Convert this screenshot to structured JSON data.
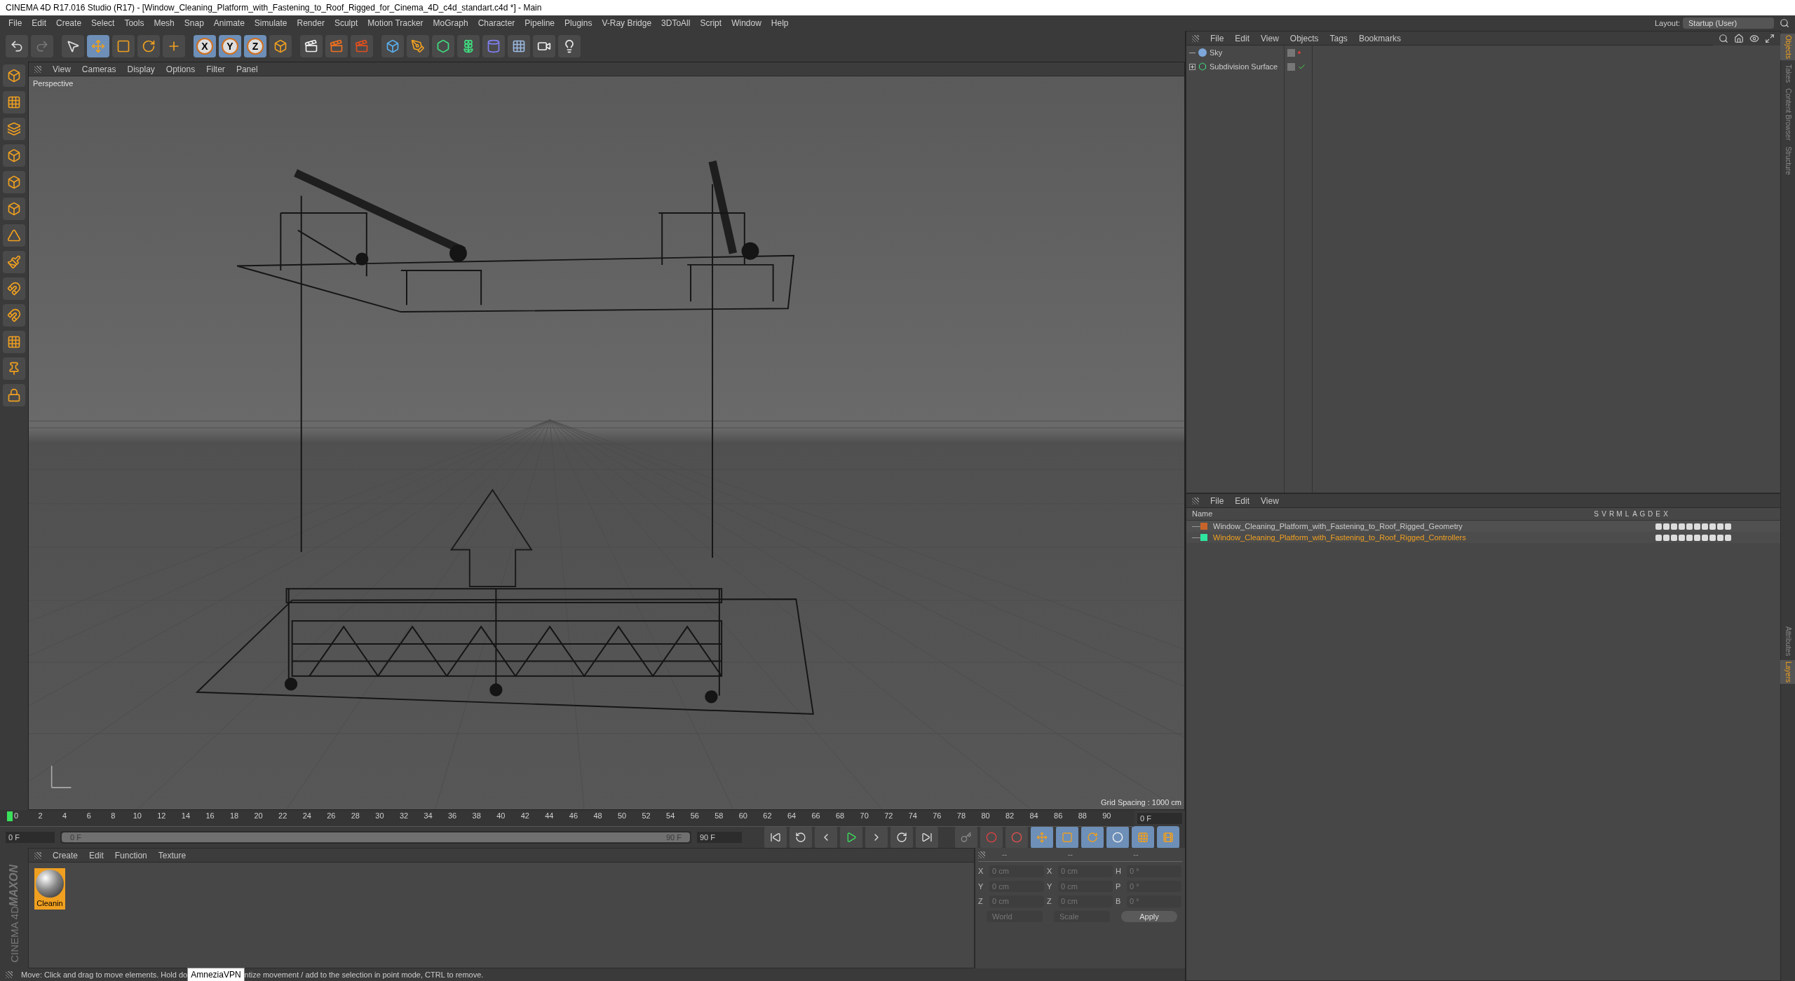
{
  "window": {
    "title": "CINEMA 4D R17.016 Studio (R17) - [Window_Cleaning_Platform_with_Fastening_to_Roof_Rigged_for_Cinema_4D_c4d_standart.c4d *] - Main"
  },
  "menu": [
    "File",
    "Edit",
    "Create",
    "Select",
    "Tools",
    "Mesh",
    "Snap",
    "Animate",
    "Simulate",
    "Render",
    "Sculpt",
    "Motion Tracker",
    "MoGraph",
    "Character",
    "Pipeline",
    "Plugins",
    "V-Ray Bridge",
    "3DToAll",
    "Script",
    "Window",
    "Help"
  ],
  "layout": {
    "label": "Layout:",
    "value": "Startup (User)"
  },
  "axis_buttons": [
    {
      "label": "X",
      "selected": true
    },
    {
      "label": "Y",
      "selected": true
    },
    {
      "label": "Z",
      "selected": true
    }
  ],
  "viewport": {
    "menu": [
      "View",
      "Cameras",
      "Display",
      "Options",
      "Filter",
      "Panel"
    ],
    "camera": "Perspective",
    "grid_spacing": "Grid Spacing : 1000 cm"
  },
  "timeline": {
    "ticks": [
      "0",
      "2",
      "4",
      "6",
      "8",
      "10",
      "12",
      "14",
      "16",
      "18",
      "20",
      "22",
      "24",
      "26",
      "28",
      "30",
      "32",
      "34",
      "36",
      "38",
      "40",
      "42",
      "44",
      "46",
      "48",
      "50",
      "52",
      "54",
      "56",
      "58",
      "60",
      "62",
      "64",
      "66",
      "68",
      "70",
      "72",
      "74",
      "76",
      "78",
      "80",
      "82",
      "84",
      "86",
      "88",
      "90"
    ],
    "current_frame": "0 F",
    "start_field": "0 F",
    "range": {
      "start": "0 F",
      "end": "90 F",
      "level": 1.0
    },
    "end_field": "90 F",
    "level": 0.0
  },
  "material_manager": {
    "menu": [
      "Create",
      "Edit",
      "Function",
      "Texture"
    ],
    "materials": [
      {
        "name": "Cleanin",
        "selected": true
      }
    ]
  },
  "brand": {
    "line1": "MAXON",
    "line2": "CINEMA 4D"
  },
  "coordinates": {
    "headers": [
      "--",
      "--",
      "--"
    ],
    "rows": [
      {
        "axis_a": "X",
        "position": "0 cm",
        "axis_b": "X",
        "size": "0 cm",
        "axis_c": "H",
        "rotation": "0 °"
      },
      {
        "axis_a": "Y",
        "position": "0 cm",
        "axis_b": "Y",
        "size": "0 cm",
        "axis_c": "P",
        "rotation": "0 °"
      },
      {
        "axis_a": "Z",
        "position": "0 cm",
        "axis_b": "Z",
        "size": "0 cm",
        "axis_c": "B",
        "rotation": "0 °"
      }
    ],
    "mode": "World",
    "size_mode": "Scale",
    "apply": "Apply"
  },
  "object_manager": {
    "menu": [
      "File",
      "Edit",
      "View",
      "Objects",
      "Tags",
      "Bookmarks"
    ],
    "objects": [
      {
        "name": "Sky",
        "kind": "sky",
        "expandable": false,
        "checked": false
      },
      {
        "name": "Subdivision Surface",
        "kind": "subdivision",
        "expandable": true,
        "checked": true
      }
    ]
  },
  "layer_manager": {
    "menu": [
      "File",
      "Edit",
      "View"
    ],
    "name_header": "Name",
    "columns": [
      "S",
      "V",
      "R",
      "M",
      "L",
      "A",
      "G",
      "D",
      "E",
      "X"
    ],
    "layers": [
      {
        "name": "Window_Cleaning_Platform_with_Fastening_to_Roof_Rigged_Geometry",
        "color": "#c8642a",
        "selected": false
      },
      {
        "name": "Window_Cleaning_Platform_with_Fastening_to_Roof_Rigged_Controllers",
        "color": "#2ee6a0",
        "selected": true
      }
    ]
  },
  "side_tabs_top": [
    {
      "label": "Objects",
      "selected": true
    },
    {
      "label": "Takes",
      "selected": false
    },
    {
      "label": "Content Browser",
      "selected": false
    },
    {
      "label": "Structure",
      "selected": false
    }
  ],
  "side_tabs_bottom": [
    {
      "label": "Attributes",
      "selected": false
    },
    {
      "label": "Layers",
      "selected": true
    }
  ],
  "status_bar": {
    "text_before": "Move: Click and drag to move elements. Hold do",
    "tooltip": "AmneziaVPN",
    "text_after": "ntize movement / add to the selection in point mode, CTRL to remove."
  }
}
